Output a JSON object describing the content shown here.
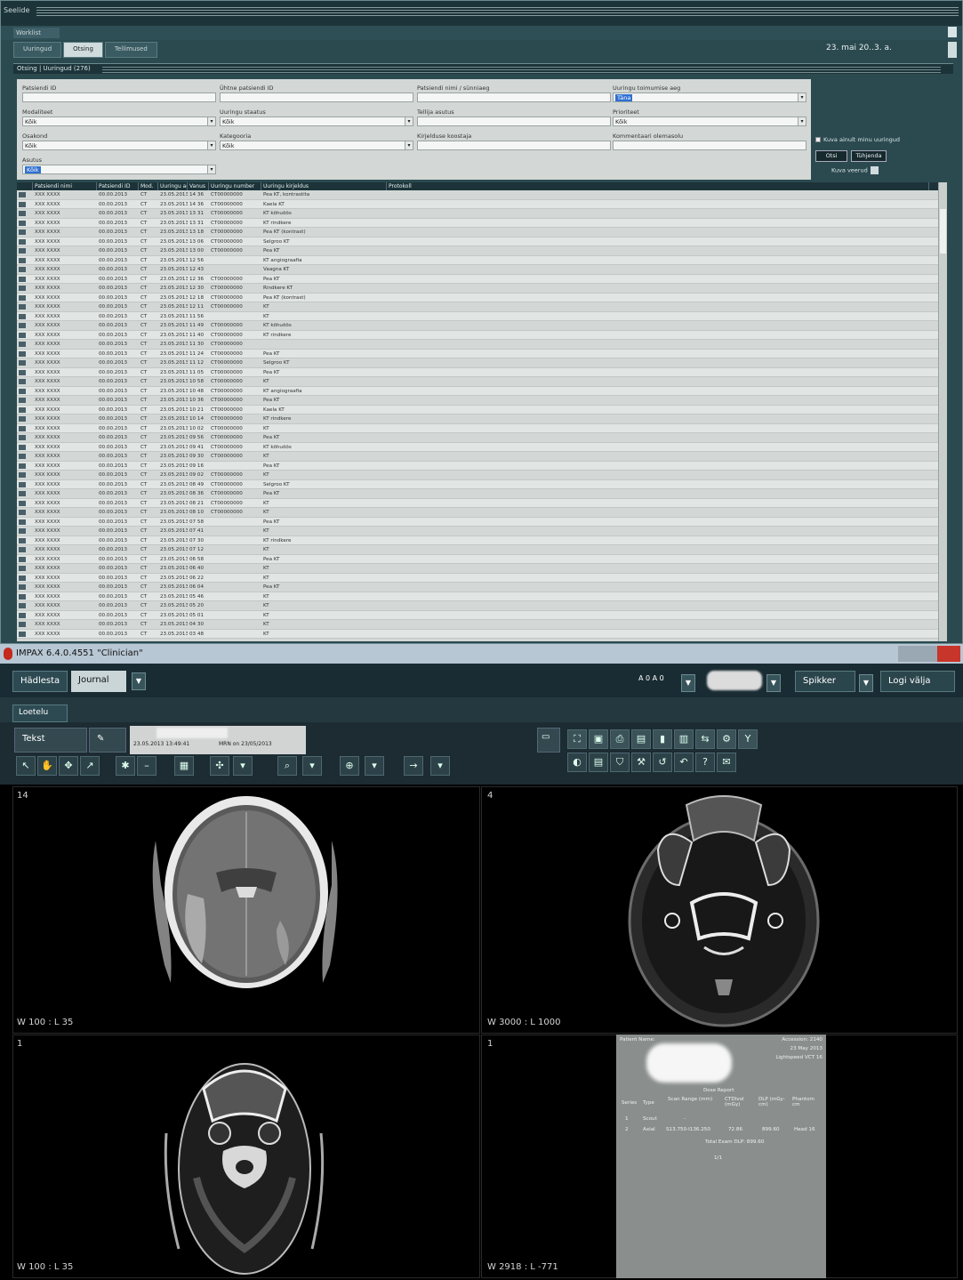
{
  "worklist": {
    "title": "Seelide",
    "menu": "Worklist",
    "tabs": [
      "Uuringud",
      "Otsing",
      "Tellimused"
    ],
    "date": "23. mai 20..3. a.",
    "filter_bar": "Otsing | Uuringud (276)",
    "filters": [
      {
        "label": "Patsiendi ID",
        "value": ""
      },
      {
        "label": "Ühtne patsiendi ID",
        "value": ""
      },
      {
        "label": "Patsiendi nimi / sünniaeg",
        "value": ""
      },
      {
        "label": "Uuringu toimumise aeg",
        "value": "Täna"
      },
      {
        "label": "Modaliteet",
        "value": "Kõik"
      },
      {
        "label": "Uuringu staatus",
        "value": "Kõik"
      },
      {
        "label": "Tellija asutus",
        "value": ""
      },
      {
        "label": "Prioriteet",
        "value": "Kõik"
      },
      {
        "label": "Osakond",
        "value": "Kõik"
      },
      {
        "label": "Kategooria",
        "value": "Kõik"
      },
      {
        "label": "Kirjelduse koostaja",
        "value": ""
      },
      {
        "label": "Kommentaari olemasolu",
        "value": ""
      },
      {
        "label": "Asutus",
        "value": "Kõik"
      }
    ],
    "checkbox": "Kuva ainult minu uuringud",
    "search_button": "Otsi",
    "clear_button": "Tühjenda",
    "options": "Kuva veerud",
    "columns": [
      "",
      "Patsiendi nimi",
      "Patsiendi ID",
      "Mod.",
      "Uuringu aeg",
      "Vanus",
      "Uuringu number",
      "Uuringu kirjeldus",
      "Protokoll"
    ],
    "rows": [
      [
        "",
        "XXX XXXX",
        "00.00.2013",
        "CT",
        "23.05.2013",
        "14 36",
        "CT00000000",
        "Pea KT, kontrastita",
        ""
      ],
      [
        "",
        "XXX XXXX",
        "00.00.2013",
        "CT",
        "23.05.2013",
        "14 36",
        "CT00000000",
        "Kaela KT",
        ""
      ],
      [
        "",
        "XXX XXXX",
        "00.00.2013",
        "CT",
        "23.05.2013",
        "13 31",
        "CT00000000",
        "KT kõhuõõs",
        ""
      ],
      [
        "",
        "XXX XXXX",
        "00.00.2013",
        "CT",
        "23.05.2013",
        "13 31",
        "CT00000000",
        "KT rindkere",
        ""
      ],
      [
        "",
        "XXX XXXX",
        "00.00.2013",
        "CT",
        "23.05.2013",
        "13 18",
        "CT00000000",
        "Pea KT (kontrast)",
        ""
      ],
      [
        "",
        "XXX XXXX",
        "00.00.2013",
        "CT",
        "23.05.2013",
        "13 06",
        "CT00000000",
        "Selgroo KT",
        ""
      ],
      [
        "",
        "XXX XXXX",
        "00.00.2013",
        "CT",
        "23.05.2013",
        "13 00",
        "CT00000000",
        "Pea KT",
        ""
      ],
      [
        "",
        "XXX XXXX",
        "00.00.2013",
        "CT",
        "23.05.2013",
        "12 56",
        "",
        "KT angiograafia",
        ""
      ],
      [
        "",
        "XXX XXXX",
        "00.00.2013",
        "CT",
        "23.05.2013",
        "12 43",
        "",
        "Vaagna KT",
        ""
      ],
      [
        "",
        "XXX XXXX",
        "00.00.2013",
        "CT",
        "23.05.2013",
        "12 36",
        "CT00000000",
        "Pea KT",
        ""
      ],
      [
        "",
        "XXX XXXX",
        "00.00.2013",
        "CT",
        "23.05.2013",
        "12 30",
        "CT00000000",
        "Rindkere KT",
        ""
      ],
      [
        "",
        "XXX XXXX",
        "00.00.2013",
        "CT",
        "23.05.2013",
        "12 18",
        "CT00000000",
        "Pea KT (kontrast)",
        ""
      ],
      [
        "",
        "XXX XXXX",
        "00.00.2013",
        "CT",
        "23.05.2013",
        "12 11",
        "CT00000000",
        "KT",
        ""
      ],
      [
        "",
        "XXX XXXX",
        "00.00.2013",
        "CT",
        "23.05.2013",
        "11 56",
        "",
        "KT",
        ""
      ],
      [
        "",
        "XXX XXXX",
        "00.00.2013",
        "CT",
        "23.05.2013",
        "11 49",
        "CT00000000",
        "KT kõhuõõs",
        ""
      ],
      [
        "",
        "XXX XXXX",
        "00.00.2013",
        "CT",
        "23.05.2013",
        "11 40",
        "CT00000000",
        "KT rindkere",
        ""
      ],
      [
        "",
        "XXX XXXX",
        "00.00.2013",
        "CT",
        "23.05.2013",
        "11 30",
        "CT00000000",
        "",
        ""
      ],
      [
        "",
        "XXX XXXX",
        "00.00.2013",
        "CT",
        "23.05.2013",
        "11 24",
        "CT00000000",
        "Pea KT",
        ""
      ],
      [
        "",
        "XXX XXXX",
        "00.00.2013",
        "CT",
        "23.05.2013",
        "11 12",
        "CT00000000",
        "Selgroo KT",
        ""
      ],
      [
        "",
        "XXX XXXX",
        "00.00.2013",
        "CT",
        "23.05.2013",
        "11 05",
        "CT00000000",
        "Pea KT",
        ""
      ],
      [
        "",
        "XXX XXXX",
        "00.00.2013",
        "CT",
        "23.05.2013",
        "10 58",
        "CT00000000",
        "KT",
        ""
      ],
      [
        "",
        "XXX XXXX",
        "00.00.2013",
        "CT",
        "23.05.2013",
        "10 48",
        "CT00000000",
        "KT angiograafia",
        ""
      ],
      [
        "",
        "XXX XXXX",
        "00.00.2013",
        "CT",
        "23.05.2013",
        "10 36",
        "CT00000000",
        "Pea KT",
        ""
      ],
      [
        "",
        "XXX XXXX",
        "00.00.2013",
        "CT",
        "23.05.2013",
        "10 21",
        "CT00000000",
        "Kaela KT",
        ""
      ],
      [
        "",
        "XXX XXXX",
        "00.00.2013",
        "CT",
        "23.05.2013",
        "10 14",
        "CT00000000",
        "KT rindkere",
        ""
      ],
      [
        "",
        "XXX XXXX",
        "00.00.2013",
        "CT",
        "23.05.2013",
        "10 02",
        "CT00000000",
        "KT",
        ""
      ],
      [
        "",
        "XXX XXXX",
        "00.00.2013",
        "CT",
        "23.05.2013",
        "09 56",
        "CT00000000",
        "Pea KT",
        ""
      ],
      [
        "",
        "XXX XXXX",
        "00.00.2013",
        "CT",
        "23.05.2013",
        "09 41",
        "CT00000000",
        "KT kõhuõõs",
        ""
      ],
      [
        "",
        "XXX XXXX",
        "00.00.2013",
        "CT",
        "23.05.2013",
        "09 30",
        "CT00000000",
        "KT",
        ""
      ],
      [
        "",
        "XXX XXXX",
        "00.00.2013",
        "CT",
        "23.05.2013",
        "09 16",
        "",
        "Pea KT",
        ""
      ],
      [
        "",
        "XXX XXXX",
        "00.00.2013",
        "CT",
        "23.05.2013",
        "09 02",
        "CT00000000",
        "KT",
        ""
      ],
      [
        "",
        "XXX XXXX",
        "00.00.2013",
        "CT",
        "23.05.2013",
        "08 49",
        "CT00000000",
        "Selgroo KT",
        ""
      ],
      [
        "",
        "XXX XXXX",
        "00.00.2013",
        "CT",
        "23.05.2013",
        "08 36",
        "CT00000000",
        "Pea KT",
        ""
      ],
      [
        "",
        "XXX XXXX",
        "00.00.2013",
        "CT",
        "23.05.2013",
        "08 21",
        "CT00000000",
        "KT",
        ""
      ],
      [
        "",
        "XXX XXXX",
        "00.00.2013",
        "CT",
        "23.05.2013",
        "08 10",
        "CT00000000",
        "KT",
        ""
      ],
      [
        "",
        "XXX XXXX",
        "00.00.2013",
        "CT",
        "23.05.2013",
        "07 58",
        "",
        "Pea KT",
        ""
      ],
      [
        "",
        "XXX XXXX",
        "00.00.2013",
        "CT",
        "23.05.2013",
        "07 41",
        "",
        "KT",
        ""
      ],
      [
        "",
        "XXX XXXX",
        "00.00.2013",
        "CT",
        "23.05.2013",
        "07 30",
        "",
        "KT rindkere",
        ""
      ],
      [
        "",
        "XXX XXXX",
        "00.00.2013",
        "CT",
        "23.05.2013",
        "07 12",
        "",
        "KT",
        ""
      ],
      [
        "",
        "XXX XXXX",
        "00.00.2013",
        "CT",
        "23.05.2013",
        "06 58",
        "",
        "Pea KT",
        ""
      ],
      [
        "",
        "XXX XXXX",
        "00.00.2013",
        "CT",
        "23.05.2013",
        "06 40",
        "",
        "KT",
        ""
      ],
      [
        "",
        "XXX XXXX",
        "00.00.2013",
        "CT",
        "23.05.2013",
        "06 22",
        "",
        "KT",
        ""
      ],
      [
        "",
        "XXX XXXX",
        "00.00.2013",
        "CT",
        "23.05.2013",
        "06 04",
        "",
        "Pea KT",
        ""
      ],
      [
        "",
        "XXX XXXX",
        "00.00.2013",
        "CT",
        "23.05.2013",
        "05 46",
        "",
        "KT",
        ""
      ],
      [
        "",
        "XXX XXXX",
        "00.00.2013",
        "CT",
        "23.05.2013",
        "05 20",
        "",
        "KT",
        ""
      ],
      [
        "",
        "XXX XXXX",
        "00.00.2013",
        "CT",
        "23.05.2013",
        "05 01",
        "",
        "KT",
        ""
      ],
      [
        "",
        "XXX XXXX",
        "00.00.2013",
        "CT",
        "23.05.2013",
        "04 30",
        "",
        "KT",
        ""
      ],
      [
        "",
        "XXX XXXX",
        "00.00.2013",
        "CT",
        "23.05.2013",
        "03 48",
        "",
        "KT",
        ""
      ]
    ]
  },
  "impax": {
    "title": "IMPAX 6.4.0.4551 \"Clinician\"",
    "nav_home": "Hädlesta",
    "nav_journal": "Journal",
    "indicator": "A 0 A 0",
    "user_button": "Spikker",
    "logout": "Logi välja",
    "viewer_tab": "Loetelu",
    "text_button": "Tekst",
    "study_date": "23.05.2013  13:49:41",
    "study_info": "MRN on 23/05/2013",
    "viewports": [
      {
        "index": "14",
        "wl": "W 100 : L 35"
      },
      {
        "index": "4",
        "wl": "W 3000 : L 1000"
      },
      {
        "index": "1",
        "wl": "W 100 : L 35"
      },
      {
        "index": "1",
        "wl": "W 2918 : L -771"
      }
    ],
    "dose_report": {
      "header_left": "Patient Name:",
      "header_right": "Accession: 2140",
      "header_right2": "23 May 2013",
      "header_right3": "Lightspeed VCT 16",
      "title": "Dose Report",
      "cols": [
        "Series",
        "Type",
        "Scan Range (mm)",
        "CTDIvol (mGy)",
        "DLP (mGy-cm)",
        "Phantom cm"
      ],
      "rows": [
        [
          "1",
          "Scout",
          "-",
          "",
          "",
          ""
        ],
        [
          "2",
          "Axial",
          "S13.750-I136.250",
          "72.86",
          "899.60",
          "Head 16"
        ]
      ],
      "total": "Total Exam DLP:    899.60",
      "page": "1/1"
    }
  }
}
